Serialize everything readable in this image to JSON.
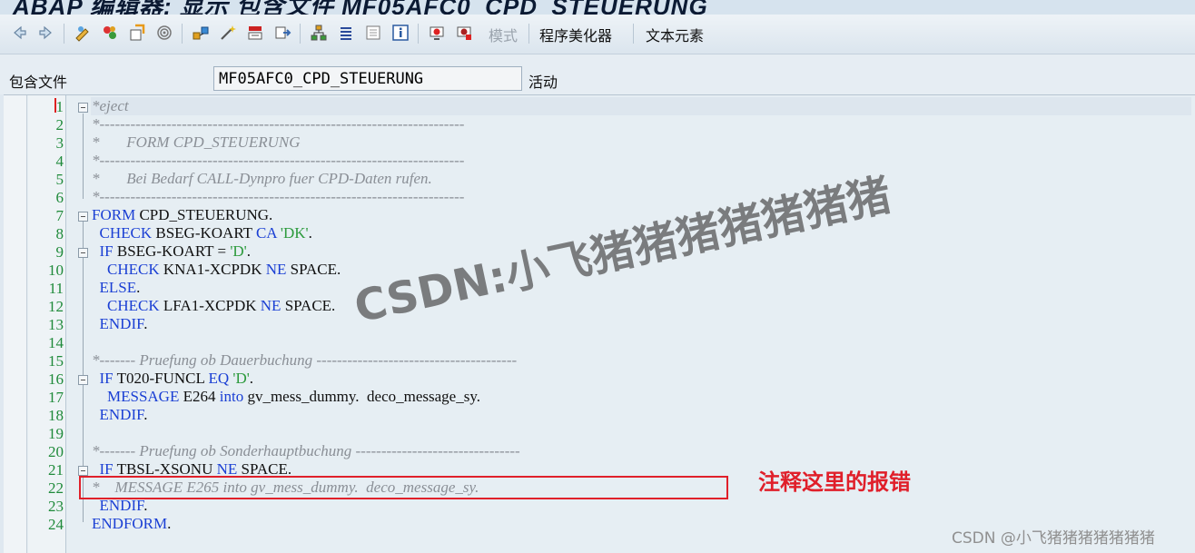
{
  "window": {
    "title": "ABAP 编辑器: 显示 包含文件 MF05AFC0_CPD_STEUERUNG"
  },
  "toolbar": {
    "mode_label": "模式",
    "pretty_printer_label": "程序美化器",
    "text_elements_label": "文本元素"
  },
  "header": {
    "include_label": "包含文件",
    "include_value": "MF05AFC0_CPD_STEUERUNG",
    "status": "活动"
  },
  "code_lines": [
    "*eject",
    "*-----------------------------------------------------------------------",
    "*       FORM CPD_STEUERUNG",
    "*-----------------------------------------------------------------------",
    "*       Bei Bedarf CALL-Dynpro fuer CPD-Daten rufen.",
    "*-----------------------------------------------------------------------",
    "FORM CPD_STEUERUNG.",
    "  CHECK BSEG-KOART CA 'DK'.",
    "  IF BSEG-KOART = 'D'.",
    "    CHECK KNA1-XCPDK NE SPACE.",
    "  ELSE.",
    "    CHECK LFA1-XCPDK NE SPACE.",
    "  ENDIF.",
    "",
    "*------- Pruefung ob Dauerbuchung ---------------------------------------",
    "  IF T020-FUNCL EQ 'D'.",
    "    MESSAGE E264 into gv_mess_dummy.  deco_message_sy.",
    "  ENDIF.",
    "",
    "*------- Pruefung ob Sonderhauptbuchung --------------------------------",
    "  IF TBSL-XSONU NE SPACE.",
    "*    MESSAGE E265 into gv_mess_dummy.  deco_message_sy.",
    "  ENDIF.",
    "ENDFORM."
  ],
  "line_numbers": [
    "1",
    "2",
    "3",
    "4",
    "5",
    "6",
    "7",
    "8",
    "9",
    "10",
    "11",
    "12",
    "13",
    "14",
    "15",
    "16",
    "17",
    "18",
    "19",
    "20",
    "21",
    "22",
    "23",
    "24"
  ],
  "annotation": {
    "note": "注释这里的报错"
  },
  "watermark": {
    "text": "CSDN:小飞猪猪猪猪猪猪猪",
    "credit": "CSDN @小飞猪猪猪猪猪猪猪"
  },
  "colors": {
    "keyword": "#1a3fd4",
    "comment": "#8a8f96",
    "string": "#2c9a3c",
    "line_number": "#1f8a3a",
    "annotation": "#e01f2a"
  }
}
